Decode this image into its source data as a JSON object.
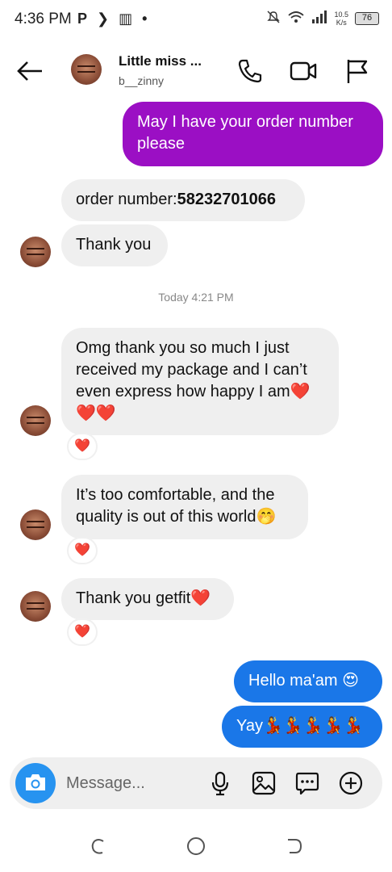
{
  "status_bar": {
    "time": "4:36 PM",
    "left_icons": [
      "P",
      "❯",
      "▥",
      "•"
    ],
    "net_speed": "10.5",
    "net_unit": "K/s",
    "battery": "76"
  },
  "header": {
    "name": "Little miss ...",
    "username": "b__zinny"
  },
  "messages": {
    "m1": "May I have your order number please",
    "m2_prefix": "order number:",
    "m2_number": "58232701066",
    "m3": "Thank you",
    "timestamp": "Today 4:21 PM",
    "m4": "Omg thank you so much I just received my package and I can’t even express how happy I am",
    "m4_end": "❤️",
    "m4_hearts": "❤️❤️",
    "m5": "It’s too comfortable, and the quality is out of this world",
    "m5_emoji": "🤭",
    "m6": "Thank you getfit",
    "m6_emoji": "❤️",
    "m7": "Hello ma'am",
    "m7_emoji": "😍",
    "m8": "Yay",
    "m8_emoji": "💃💃💃💃💃",
    "reaction": "❤️"
  },
  "composer": {
    "placeholder": "Message..."
  },
  "colors": {
    "purple": "#9b0fc4",
    "blue": "#1a77e8",
    "incoming": "#efefef",
    "camera": "#2793f0"
  }
}
